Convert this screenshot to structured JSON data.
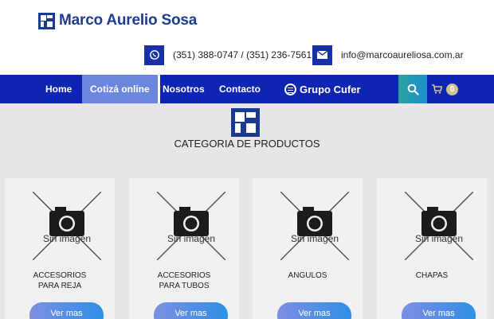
{
  "header": {
    "brand_name": "Marco Aurelio Sosa",
    "phone": "(351) 388-0747 / (351) 236-7561",
    "email": "info@marcoaureliosa.com.ar",
    "brand_color": "#1d3c92"
  },
  "nav": {
    "items": [
      "Home",
      "Cotizá online",
      "Nosotros",
      "Contacto"
    ],
    "active": "Cotizá online",
    "grupo_label": "Grupo Cufer",
    "cart_count": "0",
    "bar_color": "#0d24b5"
  },
  "main": {
    "title": "CATEGORIA DE PRODUCTOS",
    "placeholder_text": "Sin imágen",
    "button_label": "Ver mas",
    "cards": [
      {
        "line1": "ACCESORIOS",
        "line2": "PARA REJA"
      },
      {
        "line1": "ACCESORIOS",
        "line2": "PARA TUBOS"
      },
      {
        "line1": "ANGULOS",
        "line2": ""
      },
      {
        "line1": "CHAPAS",
        "line2": ""
      }
    ]
  }
}
